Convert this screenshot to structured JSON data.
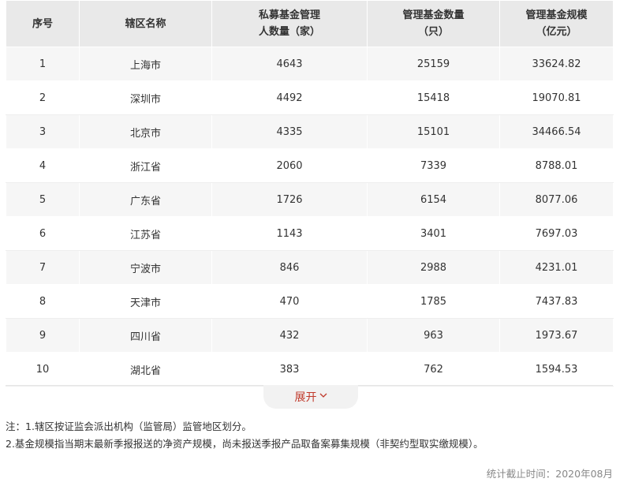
{
  "table": {
    "headers": [
      {
        "line1": "序号",
        "line2": ""
      },
      {
        "line1": "辖区名称",
        "line2": ""
      },
      {
        "line1": "私募基金管理",
        "line2": "人数量（家）"
      },
      {
        "line1": "管理基金数量",
        "line2": "（只）"
      },
      {
        "line1": "管理基金规模",
        "line2": "（亿元）"
      }
    ],
    "rows": [
      {
        "rank": "1",
        "region": "上海市",
        "managers": "4643",
        "funds": "25159",
        "scale": "33624.82"
      },
      {
        "rank": "2",
        "region": "深圳市",
        "managers": "4492",
        "funds": "15418",
        "scale": "19070.81"
      },
      {
        "rank": "3",
        "region": "北京市",
        "managers": "4335",
        "funds": "15101",
        "scale": "34466.54"
      },
      {
        "rank": "4",
        "region": "浙江省",
        "managers": "2060",
        "funds": "7339",
        "scale": "8788.01"
      },
      {
        "rank": "5",
        "region": "广东省",
        "managers": "1726",
        "funds": "6154",
        "scale": "8077.06"
      },
      {
        "rank": "6",
        "region": "江苏省",
        "managers": "1143",
        "funds": "3401",
        "scale": "7697.03"
      },
      {
        "rank": "7",
        "region": "宁波市",
        "managers": "846",
        "funds": "2988",
        "scale": "4231.01"
      },
      {
        "rank": "8",
        "region": "天津市",
        "managers": "470",
        "funds": "1785",
        "scale": "7437.83"
      },
      {
        "rank": "9",
        "region": "四川省",
        "managers": "432",
        "funds": "963",
        "scale": "1973.67"
      },
      {
        "rank": "10",
        "region": "湖北省",
        "managers": "383",
        "funds": "762",
        "scale": "1594.53"
      }
    ]
  },
  "expand": {
    "label": "展开",
    "icon": "chevron-down-icon"
  },
  "notes": {
    "line1": "注：1.辖区按证监会派出机构（监管局）监管地区划分。",
    "line2": "2.基金规模指当期末最新季报报送的净资产规模，尚未报送季报产品取备案募集规模（非契约型取实缴规模）。"
  },
  "stat_time": "统计截止时间：2020年08月",
  "colors": {
    "accent": "#c0392b",
    "header_bg": "#e9e9e9",
    "stripe_bg": "#f6f6f6"
  }
}
